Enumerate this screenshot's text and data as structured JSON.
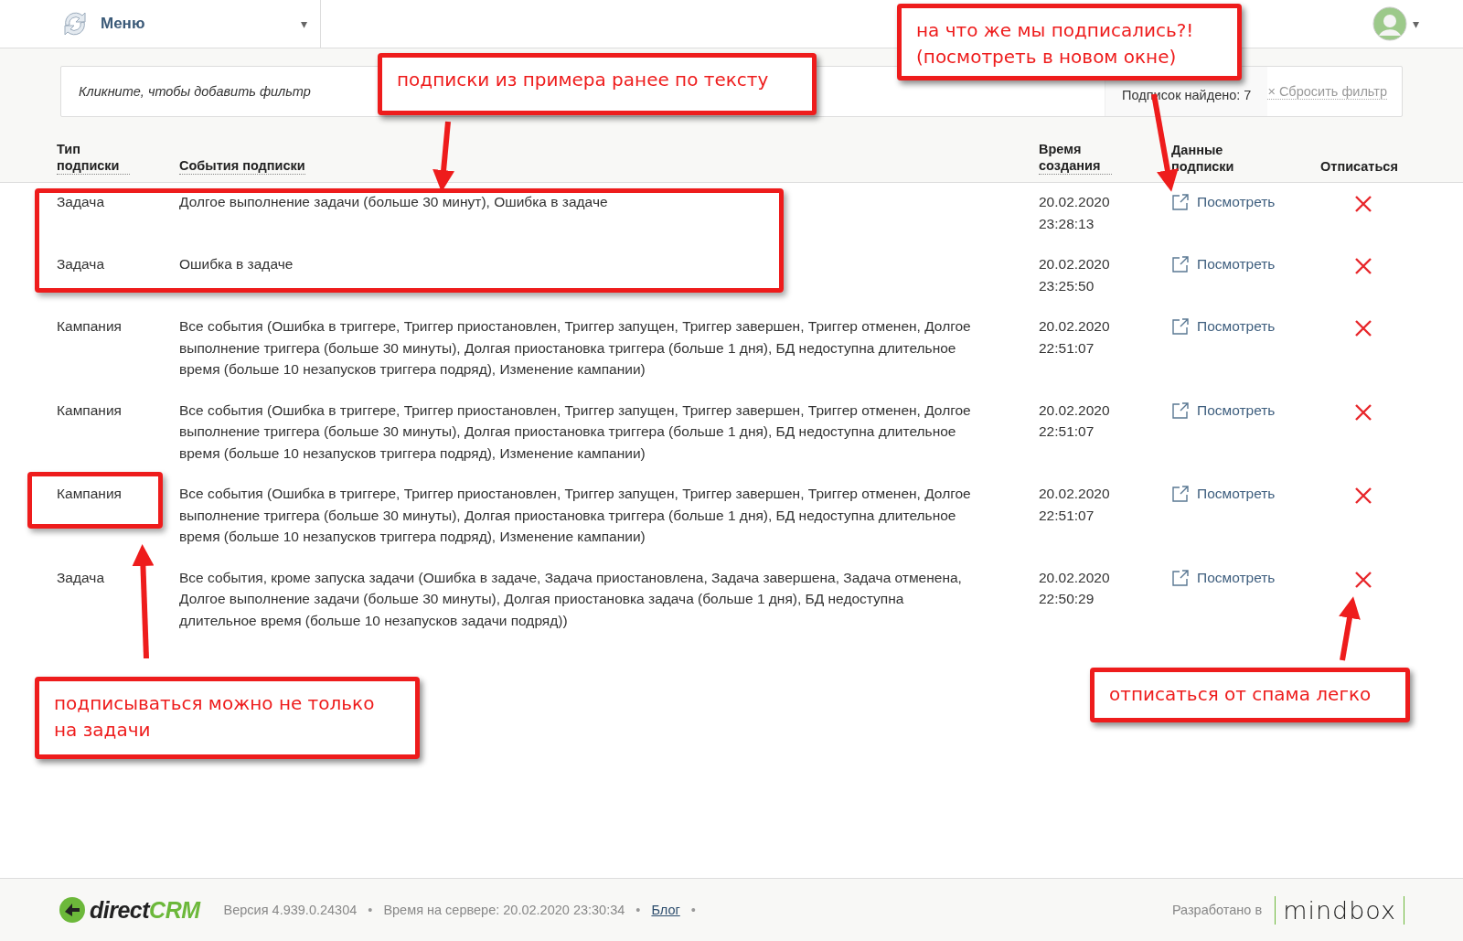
{
  "topbar": {
    "menu_label": "Меню",
    "menu_caret": "▾",
    "user_caret": "▾"
  },
  "filter": {
    "placeholder": "Кликните, чтобы добавить фильтр",
    "found": "Подписок найдено: 7",
    "reset_icon": "×",
    "reset": "Сбросить фильтр"
  },
  "table": {
    "columns": [
      "Тип подписки",
      "События подписки",
      "Время создания",
      "Данные подписки",
      "Отписаться"
    ],
    "rows": [
      {
        "type": "Задача",
        "events": "Долгое выполнение задачи (больше 30 минут), Ошибка в задаче",
        "date": "20.02.2020",
        "time": "23:28:13",
        "link": "Посмотреть"
      },
      {
        "type": "Задача",
        "events": "Ошибка в задаче",
        "date": "20.02.2020",
        "time": "23:25:50",
        "link": "Посмотреть"
      },
      {
        "type": "Кампания",
        "events": "Все события (Ошибка в триггере, Триггер приостановлен, Триггер запущен, Триггер завершен, Триггер отменен, Долгое выполнение триггера (больше 30 минуты), Долгая приостановка триггера (больше 1 дня), БД недоступна длительное время (больше 10 незапусков триггера подряд), Изменение кампании)",
        "date": "20.02.2020",
        "time": "22:51:07",
        "link": "Посмотреть"
      },
      {
        "type": "Кампания",
        "events": "Все события (Ошибка в триггере, Триггер приостановлен, Триггер запущен, Триггер завершен, Триггер отменен, Долгое выполнение триггера (больше 30 минуты), Долгая приостановка триггера (больше 1 дня), БД недоступна длительное время (больше 10 незапусков триггера подряд), Изменение кампании)",
        "date": "20.02.2020",
        "time": "22:51:07",
        "link": "Посмотреть"
      },
      {
        "type": "Кампания",
        "events": "Все события (Ошибка в триггере, Триггер приостановлен, Триггер запущен, Триггер завершен, Триггер отменен, Долгое выполнение триггера (больше 30 минуты), Долгая приостановка триггера (больше 1 дня), БД недоступна длительное время (больше 10 незапусков триггера подряд), Изменение кампании)",
        "date": "20.02.2020",
        "time": "22:51:07",
        "link": "Посмотреть"
      },
      {
        "type": "Задача",
        "events": "Все события, кроме запуска задачи (Ошибка в задаче, Задача приостановлена, Задача завершена, Задача отменена, Долгое выполнение задачи (больше 30 минуты), Долгая приостановка задача (больше 1 дня), БД недоступна длительное время (больше 10 незапусков задачи подряд))",
        "date": "20.02.2020",
        "time": "22:50:29",
        "link": "Посмотреть"
      }
    ]
  },
  "annotations": [
    {
      "kind": "callout",
      "lines": [
        "подписки из примера ранее по тексту"
      ]
    },
    {
      "kind": "callout",
      "lines": [
        "на что же мы подписались?!",
        "(посмотреть в новом окне)"
      ]
    },
    {
      "kind": "frame"
    },
    {
      "kind": "frame"
    },
    {
      "kind": "callout",
      "lines": [
        "подписываться можно не только",
        "на задачи"
      ]
    },
    {
      "kind": "callout",
      "lines": [
        "отписаться от спама легко"
      ]
    }
  ],
  "footer": {
    "separator": "•",
    "logo_direct": "direct",
    "logo_crm": "CRM",
    "version": "Версия 4.939.0.24304",
    "server_time": "Время на сервере: 20.02.2020 23:30:34",
    "blog": "Блог",
    "made_by": "Разработано в",
    "brand": "mindbox"
  }
}
